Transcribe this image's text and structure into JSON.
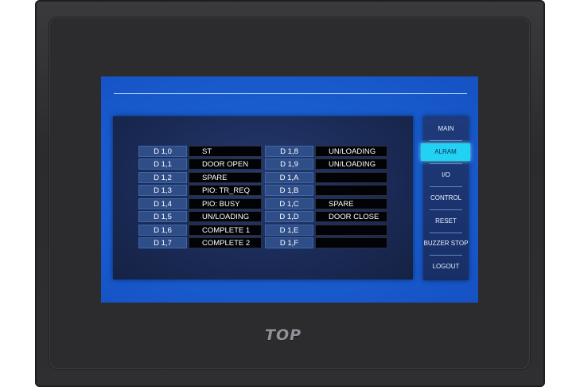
{
  "brand": {
    "logo_text": "TOP"
  },
  "io_table": {
    "left": [
      {
        "addr": "D 1,0",
        "value": "ST"
      },
      {
        "addr": "D 1,1",
        "value": "DOOR OPEN"
      },
      {
        "addr": "D 1,2",
        "value": "SPARE"
      },
      {
        "addr": "D 1,3",
        "value": "PIO: TR_REQ"
      },
      {
        "addr": "D 1,4",
        "value": "PIO: BUSY"
      },
      {
        "addr": "D 1,5",
        "value": "UN/LOADING"
      },
      {
        "addr": "D 1,6",
        "value": "COMPLETE 1"
      },
      {
        "addr": "D 1,7",
        "value": "COMPLETE 2"
      }
    ],
    "right": [
      {
        "addr": "D 1,8",
        "value": "UN/LOADING"
      },
      {
        "addr": "D 1,9",
        "value": "UN/LOADING"
      },
      {
        "addr": "D 1,A",
        "value": ""
      },
      {
        "addr": "D 1,B",
        "value": ""
      },
      {
        "addr": "D 1,C",
        "value": "SPARE"
      },
      {
        "addr": "D 1,D",
        "value": "DOOR CLOSE"
      },
      {
        "addr": "D 1,E",
        "value": ""
      },
      {
        "addr": "D 1,F",
        "value": ""
      }
    ]
  },
  "sidebar": {
    "items": [
      {
        "label": "MAIN",
        "name": "menu-main"
      },
      {
        "label": "ALRAM",
        "name": "menu-alram",
        "active": true
      },
      {
        "label": "I/O",
        "name": "menu-io"
      },
      {
        "label": "CONTROL",
        "name": "menu-control"
      },
      {
        "label": "RESET",
        "name": "menu-reset"
      },
      {
        "label": "BUZZER STOP",
        "name": "menu-buzzer-stop"
      },
      {
        "label": "LOGOUT",
        "name": "menu-logout"
      }
    ]
  },
  "colors": {
    "screen_blue": "#1a5ed0",
    "active_button": "#22d2f2",
    "address_cell": "#2f4e88",
    "value_cell": "#020307"
  }
}
